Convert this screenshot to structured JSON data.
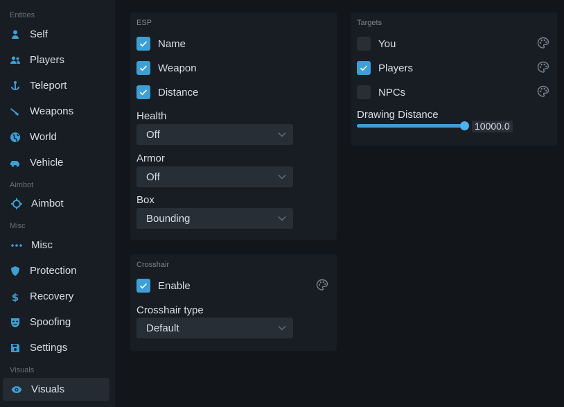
{
  "sidebar": {
    "sections": {
      "entities": "Entities",
      "aimbot": "Aimbot",
      "misc": "Misc",
      "visuals": "Visuals"
    },
    "items": [
      {
        "label": "Self",
        "icon": "user-icon"
      },
      {
        "label": "Players",
        "icon": "users-icon"
      },
      {
        "label": "Teleport",
        "icon": "anchor-icon"
      },
      {
        "label": "Weapons",
        "icon": "gun-icon"
      },
      {
        "label": "World",
        "icon": "globe-icon"
      },
      {
        "label": "Vehicle",
        "icon": "car-icon"
      },
      {
        "label": "Aimbot",
        "icon": "crosshairs-icon"
      },
      {
        "label": "Misc",
        "icon": "ellipsis-icon"
      },
      {
        "label": "Protection",
        "icon": "shield-icon"
      },
      {
        "label": "Recovery",
        "icon": "dollar-icon"
      },
      {
        "label": "Spoofing",
        "icon": "mask-icon"
      },
      {
        "label": "Settings",
        "icon": "save-icon"
      },
      {
        "label": "Visuals",
        "icon": "eye-icon",
        "active": true
      }
    ]
  },
  "esp": {
    "title": "ESP",
    "checkboxes": [
      {
        "label": "Name",
        "checked": true
      },
      {
        "label": "Weapon",
        "checked": true
      },
      {
        "label": "Distance",
        "checked": true
      }
    ],
    "health": {
      "label": "Health",
      "value": "Off"
    },
    "armor": {
      "label": "Armor",
      "value": "Off"
    },
    "box": {
      "label": "Box",
      "value": "Bounding"
    }
  },
  "crosshair": {
    "title": "Crosshair",
    "enable": {
      "label": "Enable",
      "checked": true
    },
    "type": {
      "label": "Crosshair type",
      "value": "Default"
    }
  },
  "targets": {
    "title": "Targets",
    "checkboxes": [
      {
        "label": "You",
        "checked": false
      },
      {
        "label": "Players",
        "checked": true
      },
      {
        "label": "NPCs",
        "checked": false
      }
    ],
    "drawing_distance": {
      "label": "Drawing Distance",
      "value": "10000.0",
      "fraction": 1.0
    }
  },
  "colors": {
    "accent": "#3d9fd6",
    "background": "#12161b",
    "panel": "#181d23",
    "control": "#272e36"
  }
}
